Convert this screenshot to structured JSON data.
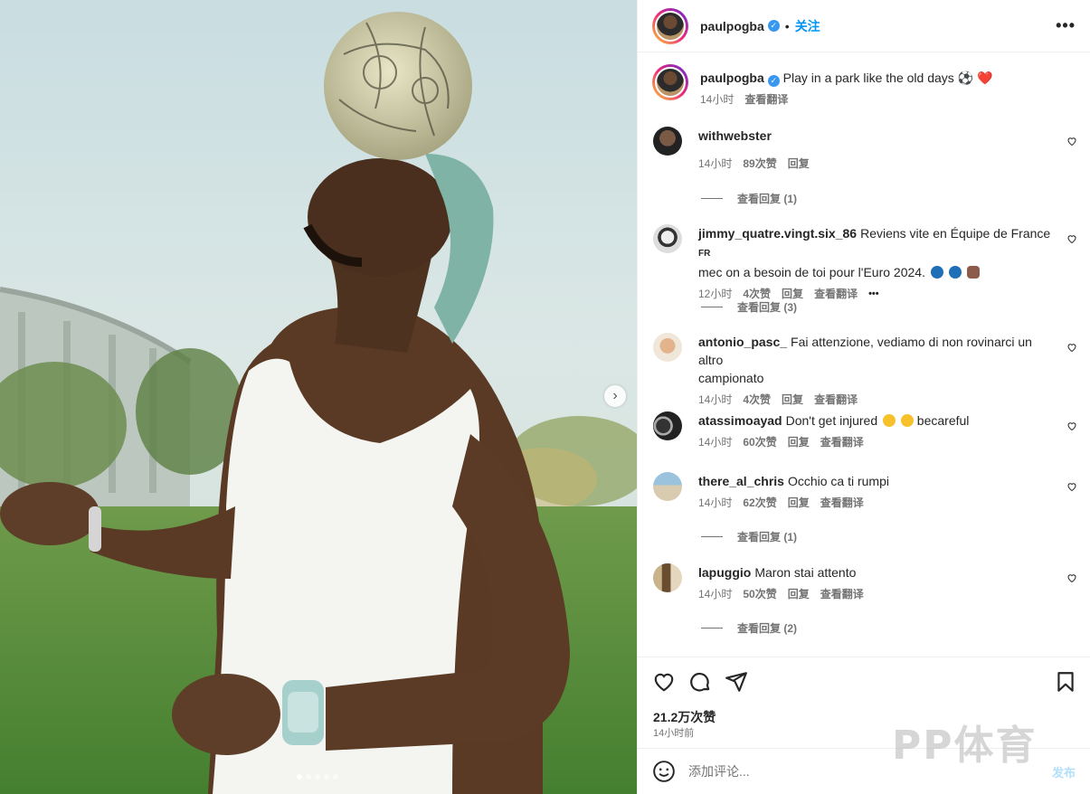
{
  "post": {
    "username": "paulpogba",
    "follow_label": "关注",
    "more_label": "•••",
    "separator": "•",
    "caption_text": "Play in a park like the old days",
    "caption_emojis": "⚽ ❤️",
    "caption_time": "14小时",
    "caption_translate": "查看翻译"
  },
  "comments": [
    {
      "username": "withwebster",
      "text": "",
      "time": "14小时",
      "likes": "89次赞",
      "reply": "回复",
      "translate": "",
      "view_replies": "查看回复 (1)"
    },
    {
      "username": "jimmy_quatre.vingt.six_86",
      "text": "Reviens vite en Équipe de France ",
      "text_flag": "FR",
      "text2": "mec on a besoin de toi pour l'Euro 2024.",
      "time": "12小时",
      "likes": "4次赞",
      "reply": "回复",
      "translate": "查看翻译",
      "more": "•••",
      "view_replies": "查看回复 (3)"
    },
    {
      "username": "antonio_pasc_",
      "text": "Fai attenzione, vediamo di non rovinarci un altro",
      "text2": "campionato",
      "time": "14小时",
      "likes": "4次赞",
      "reply": "回复",
      "translate": "查看翻译",
      "view_replies": ""
    },
    {
      "username": "atassimoayad",
      "text": "Don't get injured",
      "text_tail": "becareful",
      "time": "14小时",
      "likes": "60次赞",
      "reply": "回复",
      "translate": "查看翻译",
      "view_replies": ""
    },
    {
      "username": "there_al_chris",
      "text": "Occhio ca ti rumpi",
      "time": "14小时",
      "likes": "62次赞",
      "reply": "回复",
      "translate": "查看翻译",
      "view_replies": "查看回复 (1)"
    },
    {
      "username": "lapuggio",
      "text": "Maron stai attento",
      "time": "14小时",
      "likes": "50次赞",
      "reply": "回复",
      "translate": "查看翻译",
      "view_replies": "查看回复 (2)"
    }
  ],
  "footer": {
    "likes_count": "21.2万次赞",
    "posted_time": "14小时前",
    "comment_placeholder": "添加评论...",
    "post_button": "发布"
  },
  "watermark": "PP体育",
  "carousel": {
    "total_slides": 5,
    "active_slide": 1
  },
  "icons": [
    "verified-badge-icon",
    "more-options-icon",
    "heart-icon",
    "comment-icon",
    "share-icon",
    "bookmark-icon",
    "emoji-icon",
    "chevron-right-icon"
  ],
  "colors": {
    "accent": "#0095f6",
    "text": "#262626",
    "muted": "#737373",
    "border": "#efefef"
  }
}
